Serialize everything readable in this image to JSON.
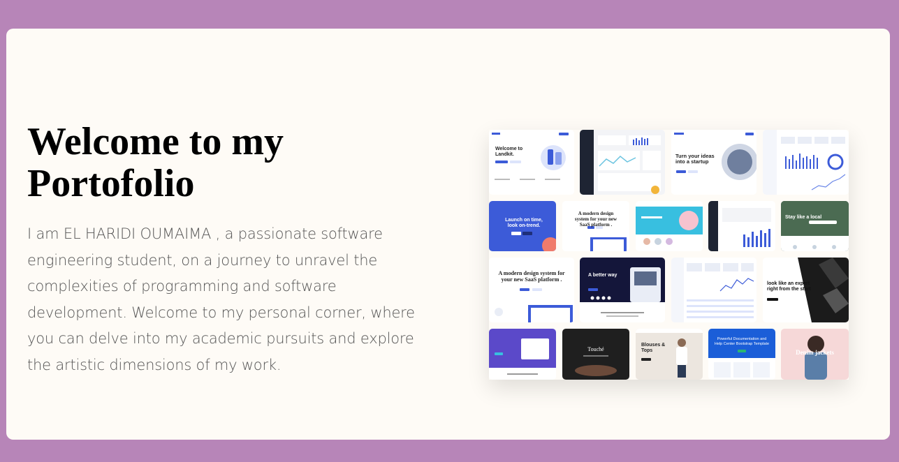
{
  "hero": {
    "title_line1": "Welcome to my",
    "title_line2": "Portofolio",
    "description": "I am EL HARIDI OUMAIMA , a passionate software engineering student, on a journey to unravel the complexities of programming and software development. Welcome to my personal corner, where you can delve into my academic pursuits and explore the artistic dimensions of my work."
  },
  "collage": {
    "tiles": {
      "t1": "Welcome to Landkit.",
      "t2": "Turn your ideas into a startup",
      "t3": "Launch on time, look on-trend.",
      "t4": "A modern design system for your new SaaS platform .",
      "t5": "Stay like a local",
      "t6": "A modern design system for your new SaaS platform .",
      "t7": "A better way",
      "t8": "look like an expert right from the start",
      "t9": "Touché",
      "t10": "Blouses & Tops",
      "t11": "Powerful Documentation and Help Center Bootstrap Template",
      "t12": "Denim jackets"
    }
  },
  "colors": {
    "page_background": "#b785b8",
    "card_background": "#fefbf6",
    "accent_blue": "#3c5bd8"
  }
}
